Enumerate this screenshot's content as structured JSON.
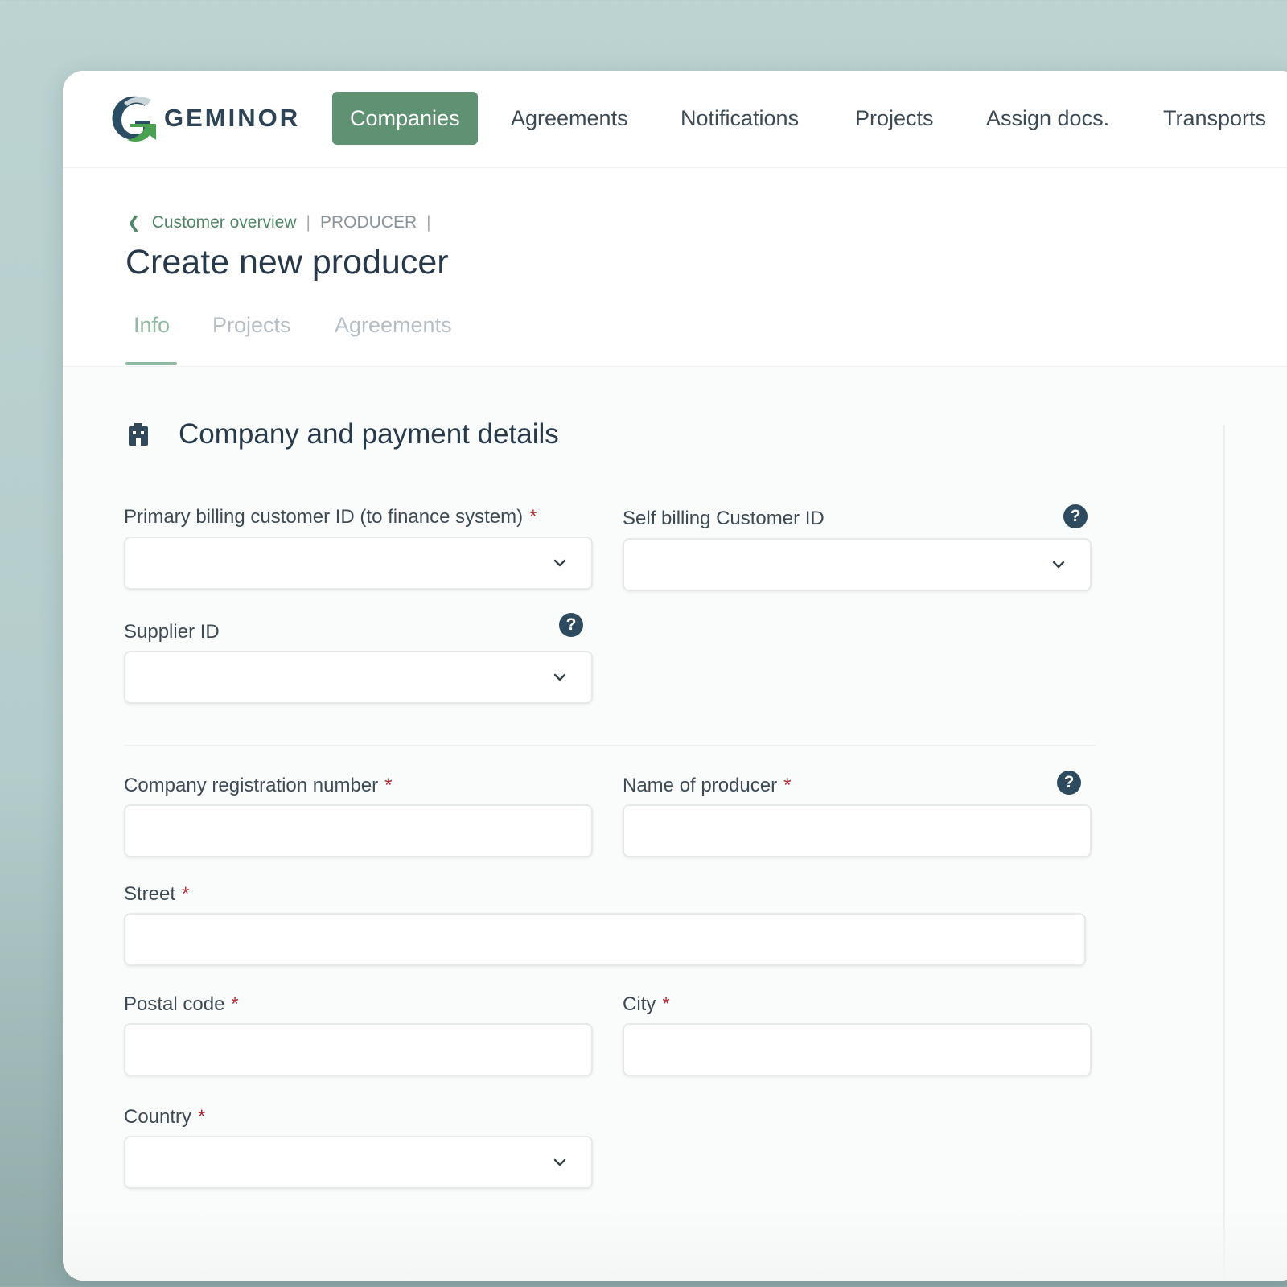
{
  "brand": {
    "name": "GEMINOR"
  },
  "nav": {
    "items": [
      {
        "label": "Companies",
        "active": true
      },
      {
        "label": "Agreements",
        "active": false
      },
      {
        "label": "Notifications",
        "active": false
      },
      {
        "label": "Projects",
        "active": false
      },
      {
        "label": "Assign docs.",
        "active": false
      },
      {
        "label": "Transports",
        "active": false
      }
    ]
  },
  "breadcrumb": {
    "back_link": "Customer overview",
    "separator": "|",
    "current": "PRODUCER"
  },
  "page": {
    "title": "Create new producer"
  },
  "tabs": [
    {
      "label": "Info",
      "active": true
    },
    {
      "label": "Projects",
      "active": false
    },
    {
      "label": "Agreements",
      "active": false
    }
  ],
  "section": {
    "title": "Company and payment details",
    "icon": "building-icon"
  },
  "form": {
    "required_marker": "*",
    "help_glyph": "?",
    "primary_billing_id": {
      "label": "Primary billing customer ID (to finance system)",
      "required": true,
      "value": ""
    },
    "self_billing_id": {
      "label": "Self billing Customer ID",
      "required": false,
      "value": ""
    },
    "supplier_id": {
      "label": "Supplier ID",
      "required": false,
      "value": ""
    },
    "company_registration_number": {
      "label": "Company registration number",
      "required": true,
      "value": ""
    },
    "name_of_producer": {
      "label": "Name of producer",
      "required": true,
      "value": ""
    },
    "street": {
      "label": "Street",
      "required": true,
      "value": ""
    },
    "postal_code": {
      "label": "Postal code",
      "required": true,
      "value": ""
    },
    "city": {
      "label": "City",
      "required": true,
      "value": ""
    },
    "country": {
      "label": "Country",
      "required": true,
      "value": ""
    }
  },
  "colors": {
    "accent": "#5e9273",
    "link": "#4f8766",
    "required": "#b0303a",
    "help_badge": "#2e4a5e",
    "tab_active": "#8fb9a0"
  }
}
